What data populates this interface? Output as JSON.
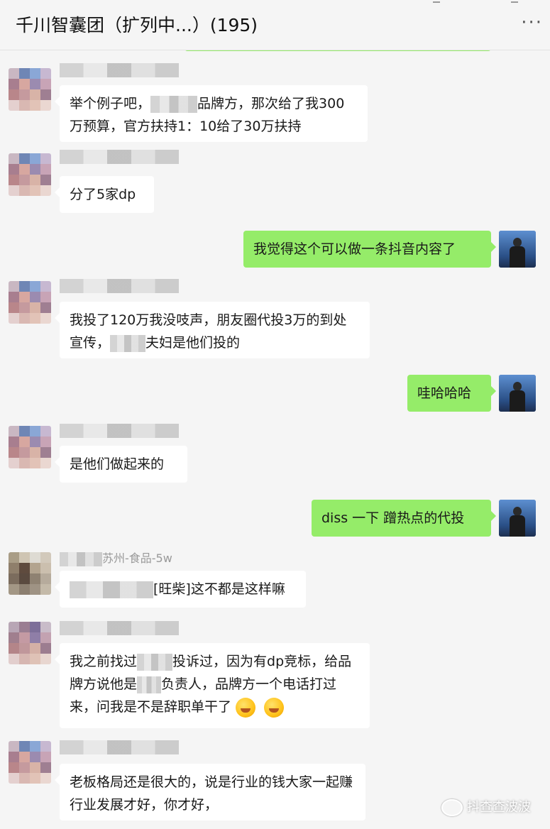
{
  "header": {
    "title": "千川智囊团（扩列中...）(195)",
    "more": "···"
  },
  "messages": [
    {
      "side": "left",
      "text_a": "举个例子吧，",
      "text_b": "品牌方，那次给了我300万预算，官方扶持1：10给了30万扶持"
    },
    {
      "side": "left",
      "text_a": "分了5家dp"
    },
    {
      "side": "right",
      "text_a": "我觉得这个可以做一条抖音内容了"
    },
    {
      "side": "left",
      "text_a": "我投了120万我没吱声，朋友圈代投3万的到处宣传，",
      "text_b": "夫妇是他们投的"
    },
    {
      "side": "right",
      "text_a": "哇哈哈哈"
    },
    {
      "side": "left",
      "text_a": "是他们做起来的"
    },
    {
      "side": "right",
      "text_a": "diss 一下 蹭热点的代投"
    },
    {
      "side": "left",
      "nickname": "苏州-食品-5w",
      "text_a": "[旺柴]这不都是这样嘛"
    },
    {
      "side": "left",
      "text_a": "我之前找过",
      "text_b": "投诉过，因为有dp竞标，给品牌方说他是",
      "text_c": "负责人，品牌方一个电话打过来，问我是不是辞职单干了"
    },
    {
      "side": "left",
      "text_a": "老板格局还是很大的，说是行业的钱大家一起赚行业发展才好，你才好，"
    }
  ],
  "watermark": "抖查查波波",
  "colors": {
    "background": "#f5f5f5",
    "bubble_self": "#95ec69",
    "bubble_other": "#ffffff"
  }
}
